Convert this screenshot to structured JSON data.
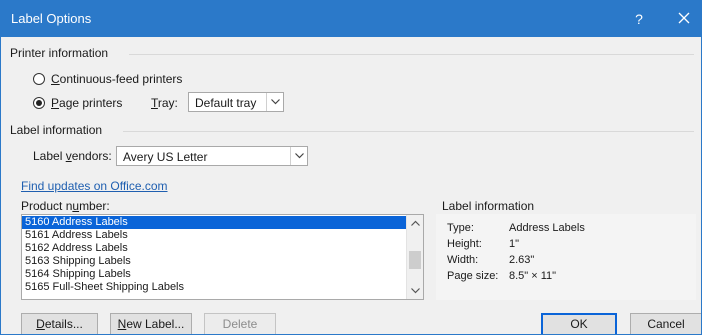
{
  "window": {
    "title": "Label Options",
    "help_label": "?",
    "close_label": "✕"
  },
  "printer_info": {
    "section_title": "Printer information",
    "continuous_feed": {
      "mnemonic": "C",
      "rest": "ontinuous-feed printers",
      "checked": false
    },
    "page_printers": {
      "mnemonic": "P",
      "rest": "age printers",
      "checked": true
    },
    "tray": {
      "mnemonic": "T",
      "rest": "ray:",
      "value": "Default tray"
    }
  },
  "label_info": {
    "section_title": "Label information",
    "vendors": {
      "prefix": "Label ",
      "mnemonic": "v",
      "rest": "endors:",
      "value": "Avery US Letter"
    }
  },
  "updates_link": "Find updates on Office.com",
  "product_number": {
    "prefix": "Product n",
    "mnemonic": "u",
    "rest": "mber:",
    "items": [
      "5160 Address Labels",
      "5161 Address Labels",
      "5162 Address Labels",
      "5163 Shipping Labels",
      "5164 Shipping Labels",
      "5165 Full-Sheet Shipping Labels"
    ],
    "selected_index": 0
  },
  "label_details": {
    "title": "Label information",
    "rows": [
      {
        "key": "Type:",
        "value": "Address Labels"
      },
      {
        "key": "Height:",
        "value": "1\""
      },
      {
        "key": "Width:",
        "value": "2.63\""
      },
      {
        "key": "Page size:",
        "value": "8.5\" × 11\""
      }
    ]
  },
  "buttons": {
    "details": {
      "mnemonic": "D",
      "rest": "etails..."
    },
    "new_label": {
      "mnemonic": "N",
      "rest": "ew Label..."
    },
    "delete": "Delete",
    "ok": "OK",
    "cancel": "Cancel"
  },
  "colors": {
    "titlebar": "#2b79c9",
    "selection": "#0a64d8",
    "link": "#1f5fb0"
  }
}
